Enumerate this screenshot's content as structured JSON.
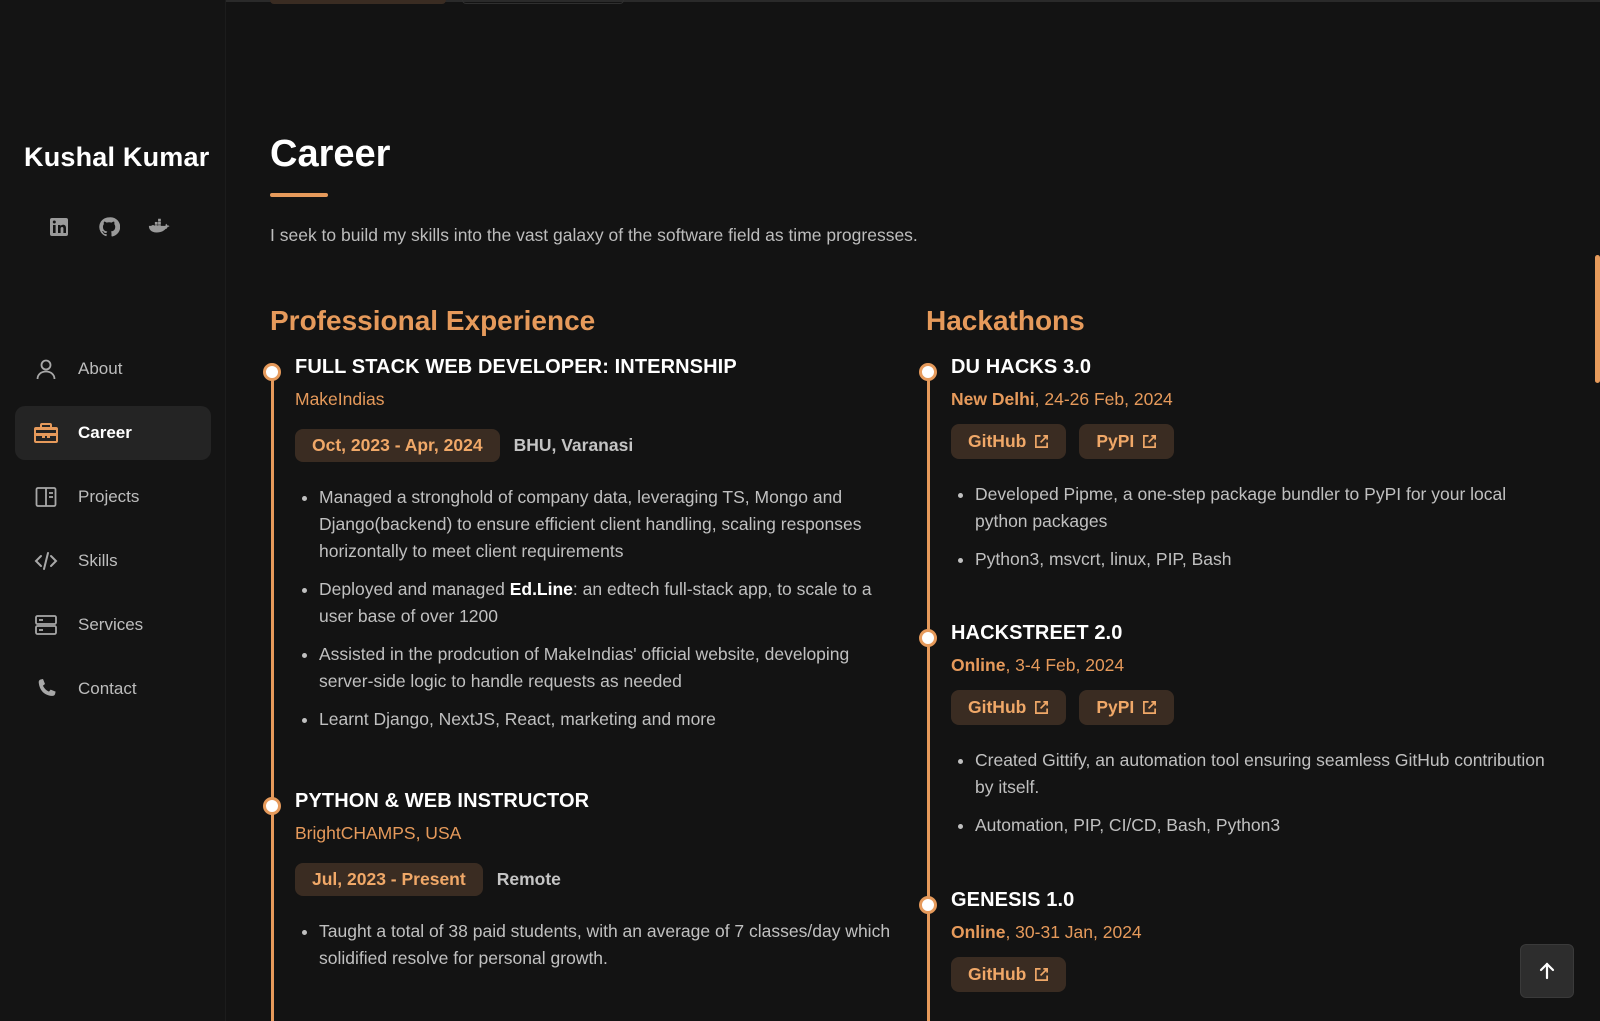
{
  "sidebar": {
    "brand": "Kushal Kumar",
    "socials": [
      {
        "icon": "linkedin-icon"
      },
      {
        "icon": "github-icon"
      },
      {
        "icon": "docker-icon"
      }
    ],
    "nav": [
      {
        "label": "About",
        "icon": "user-icon",
        "active": false
      },
      {
        "label": "Career",
        "icon": "briefcase-icon",
        "active": true
      },
      {
        "label": "Projects",
        "icon": "book-icon",
        "active": false
      },
      {
        "label": "Skills",
        "icon": "code-icon",
        "active": false
      },
      {
        "label": "Services",
        "icon": "server-icon",
        "active": false
      },
      {
        "label": "Contact",
        "icon": "phone-icon",
        "active": false
      }
    ]
  },
  "main": {
    "title": "Career",
    "intro": "I seek to build my skills into the vast galaxy of the software field as time progresses.",
    "experience": {
      "title": "Professional Experience",
      "entries": [
        {
          "role": "FULL STACK WEB DEVELOPER: INTERNSHIP",
          "company": "MakeIndias",
          "dates": "Oct, 2023 - Apr, 2024",
          "location": "BHU, Varanasi",
          "bullets": [
            "Managed a stronghold of company data, leveraging TS, Mongo and Django(backend) to ensure efficient client handling, scaling responses horizontally to meet client requirements",
            {
              "pre": "Deployed and managed ",
              "bold": "Ed.Line",
              "post": ": an edtech full-stack app, to scale to a user base of over 1200"
            },
            "Assisted in the prodcution of MakeIndias' official website, developing server-side logic to handle requests as needed",
            "Learnt Django, NextJS, React, marketing and more"
          ]
        },
        {
          "role": "PYTHON & WEB INSTRUCTOR",
          "company": "BrightCHAMPS, USA",
          "dates": "Jul, 2023 - Present",
          "location": "Remote",
          "bullets": [
            "Taught a total of 38 paid students, with an average of 7 classes/day which solidified resolve for personal growth."
          ]
        }
      ]
    },
    "hackathons": {
      "title": "Hackathons",
      "entries": [
        {
          "name": "DU HACKS 3.0",
          "place": "New Delhi",
          "date": ", 24-26 Feb, 2024",
          "links": [
            "GitHub",
            "PyPI"
          ],
          "bullets": [
            "Developed Pipme, a one-step package bundler to PyPI for your local python packages",
            "Python3, msvcrt, linux, PIP, Bash"
          ]
        },
        {
          "name": "HACKSTREET 2.0",
          "place": "Online",
          "date": ", 3-4 Feb, 2024",
          "links": [
            "GitHub",
            "PyPI"
          ],
          "bullets": [
            "Created Gittify, an automation tool ensuring seamless GitHub contribution by itself.",
            "Automation, PIP, CI/CD, Bash, Python3"
          ]
        },
        {
          "name": "GENESIS 1.0",
          "place": "Online",
          "date": ", 30-31 Jan, 2024",
          "links": [
            "GitHub"
          ]
        }
      ]
    }
  },
  "colors": {
    "accent": "#e69a5b",
    "pill_bg": "#3a2c22",
    "background": "#131313",
    "active_nav_bg": "#242424"
  },
  "controls": {
    "scroll_top_icon": "arrow-up-icon"
  }
}
